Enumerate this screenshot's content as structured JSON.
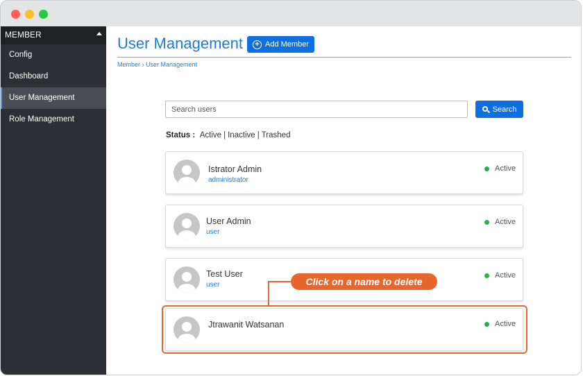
{
  "sidebar": {
    "header": "MEMBER",
    "items": [
      {
        "label": "Config"
      },
      {
        "label": "Dashboard"
      },
      {
        "label": "User Management"
      },
      {
        "label": "Role Management"
      }
    ]
  },
  "header": {
    "title": "User Management",
    "add_button": "Add Member"
  },
  "breadcrumb": {
    "root": "Member",
    "separator": "›",
    "current": "User Management"
  },
  "search": {
    "placeholder": "Search users",
    "button_label": "Search"
  },
  "status_filter": {
    "label": "Status :",
    "options": [
      "Active",
      "Inactive",
      "Trashed"
    ],
    "separator": "|"
  },
  "users": [
    {
      "name": "Istrator Admin",
      "role": "administrator",
      "status": "Active"
    },
    {
      "name": "User Admin",
      "role": "user",
      "status": "Active"
    },
    {
      "name": "Test User",
      "role": "user",
      "status": "Active"
    },
    {
      "name": "Jtrawanit Watsanan",
      "role": "",
      "status": "Active"
    }
  ],
  "annotation": {
    "callout_text": "Click on a name to delete"
  },
  "colors": {
    "accent": "#1d7cd6",
    "button": "#0d6fe0",
    "sidebar": "#2c2f33",
    "callout": "#e8652e",
    "active_status": "#2eae4b"
  }
}
